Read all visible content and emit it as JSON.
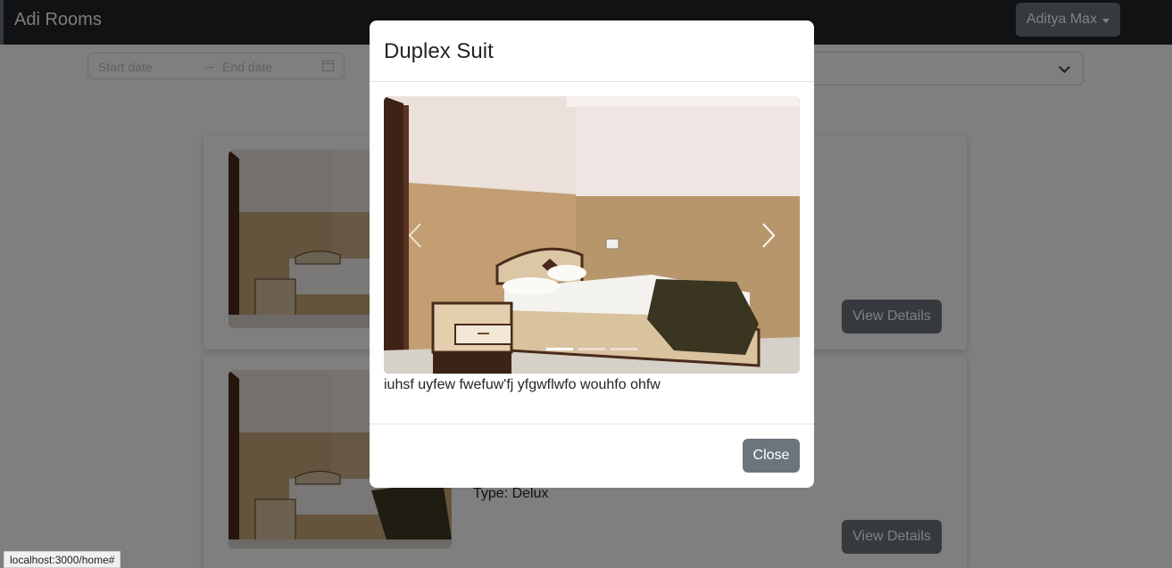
{
  "navbar": {
    "brand": "Adi Rooms",
    "user_menu_label": "Aditya Max"
  },
  "filters": {
    "start_date_placeholder": "Start date",
    "range_separator": "→",
    "end_date_placeholder": "End date",
    "type_select_value": ""
  },
  "rooms": [
    {
      "type_label": "",
      "view_details_label": "View Details"
    },
    {
      "type_label": "Type: Delux",
      "view_details_label": "View Details"
    }
  ],
  "modal": {
    "title": "Duplex Suit",
    "description": "iuhsf uyfew fwefuw'fj yfgwflwfo wouhfo ohfw",
    "close_label": "Close",
    "carousel": {
      "slide_count": 3,
      "active_slide": 1
    }
  },
  "status_bar": {
    "url": "localhost:3000/home#"
  },
  "colors": {
    "navbar_bg": "#212529",
    "button_secondary": "#6c757d",
    "backdrop": "rgba(0,0,0,0.5)"
  },
  "icons": [
    "calendar-icon",
    "chevron-down-icon",
    "caret-down-icon",
    "chevron-left-icon",
    "chevron-right-icon"
  ]
}
